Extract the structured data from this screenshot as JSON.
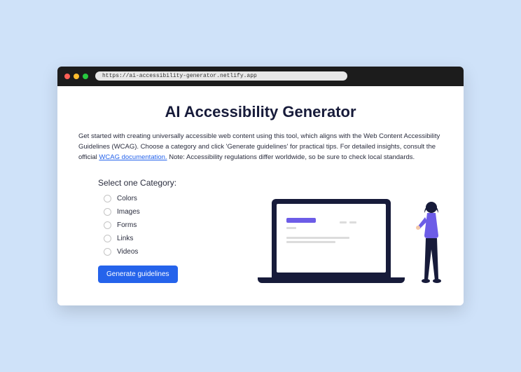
{
  "browser": {
    "url": "https://ai-accessibility-generator.netlify.app"
  },
  "page": {
    "title": "AI Accessibility Generator",
    "description_part1": "Get started with creating universally accessible web content using this tool, which aligns with the Web Content Accessibility Guidelines (WCAG). Choose a category and click 'Generate guidelines' for practical tips. For detailed insights, consult the official ",
    "description_link": "WCAG documentation.",
    "description_part2": "  Note: Accessibility regulations differ worldwide, so be sure to check local standards."
  },
  "category": {
    "heading": "Select one Category:",
    "options": [
      {
        "label": "Colors"
      },
      {
        "label": "Images"
      },
      {
        "label": "Forms"
      },
      {
        "label": "Links"
      },
      {
        "label": "Videos"
      }
    ]
  },
  "button": {
    "generate": "Generate guidelines"
  }
}
